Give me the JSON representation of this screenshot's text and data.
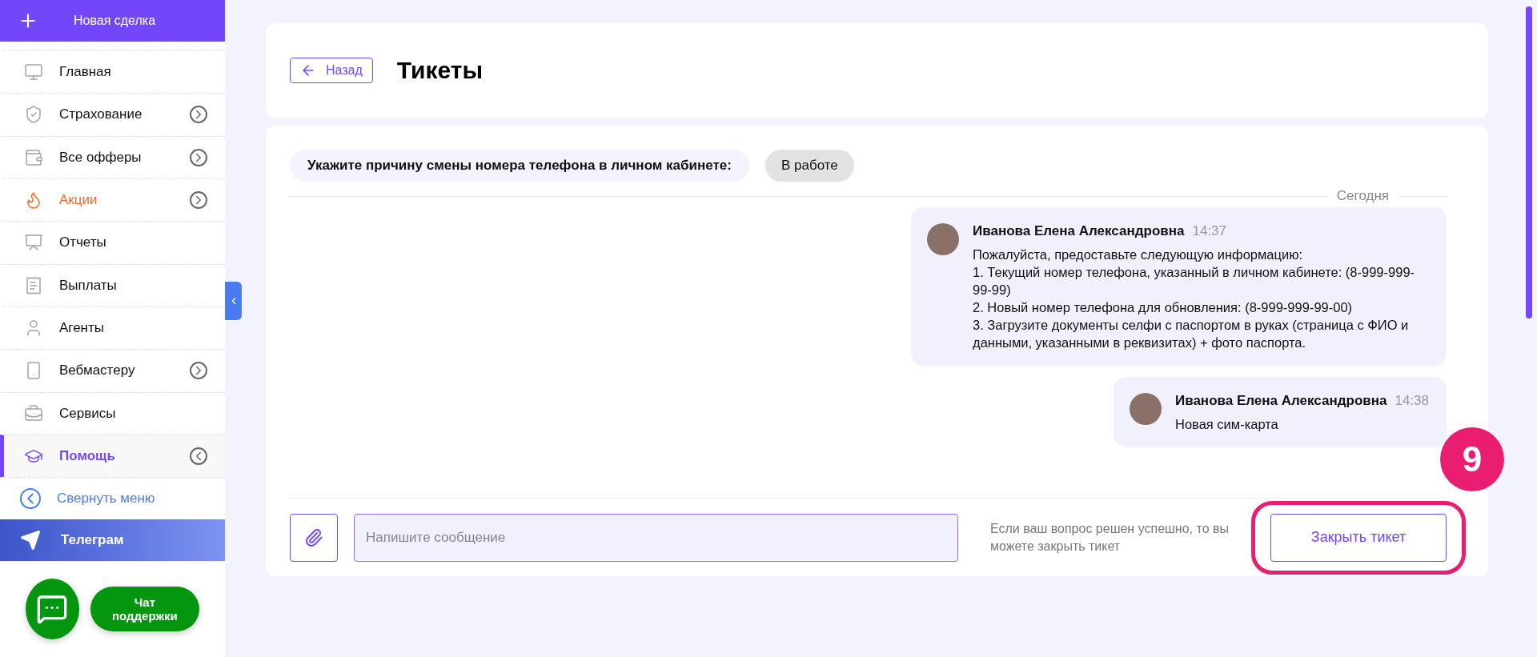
{
  "sidebar": {
    "new_deal": "Новая сделка",
    "items": [
      {
        "label": "Главная",
        "kind": "normal",
        "arrow": false,
        "selected": false
      },
      {
        "label": "Страхование",
        "kind": "normal",
        "arrow": true,
        "selected": false,
        "expanded": false
      },
      {
        "label": "Все офферы",
        "kind": "normal",
        "arrow": true,
        "selected": false,
        "expanded": false
      },
      {
        "label": "Акции",
        "kind": "promo",
        "arrow": true,
        "selected": false,
        "expanded": false
      },
      {
        "label": "Отчеты",
        "kind": "normal",
        "arrow": false,
        "selected": false
      },
      {
        "label": "Выплаты",
        "kind": "normal",
        "arrow": false,
        "selected": false
      },
      {
        "label": "Агенты",
        "kind": "normal",
        "arrow": false,
        "selected": false
      },
      {
        "label": "Вебмастеру",
        "kind": "normal",
        "arrow": true,
        "selected": false,
        "expanded": false
      },
      {
        "label": "Сервисы",
        "kind": "normal",
        "arrow": false,
        "selected": false
      },
      {
        "label": "Помощь",
        "kind": "normal",
        "arrow": true,
        "selected": true,
        "expanded": true
      }
    ],
    "collapse": "Свернуть меню",
    "telegram": "Телеграм",
    "support_chat": "Чат поддержки"
  },
  "header": {
    "back": "Назад",
    "title": "Тикеты"
  },
  "ticket": {
    "subject": "Укажите причину смены номера телефона в личном кабинете:",
    "status": "В работе",
    "day": "Сегодня",
    "messages": [
      {
        "author": "Иванова Елена Александровна",
        "time": "14:37",
        "lines": [
          "Пожалуйста, предоставьте следующую информацию:",
          "1. Текущий номер телефона, указанный в личном кабинете: (8-999-999-99-99)",
          "2. Новый номер телефона для обновления: (8-999-999-99-00)",
          "3. Загрузите документы селфи с паспортом в руках (страница с ФИО и данными, указанными в реквизитах) + фото паспорта."
        ]
      },
      {
        "author": "Иванова Елена Александровна",
        "time": "14:38",
        "lines": [
          "Новая сим-карта"
        ]
      }
    ],
    "composer": {
      "placeholder": "Напишите сообщение"
    },
    "hint": "Если ваш вопрос решен успешно, то вы можете закрыть тикет",
    "close": "Закрыть тикет"
  },
  "annotation": {
    "label": "9"
  }
}
